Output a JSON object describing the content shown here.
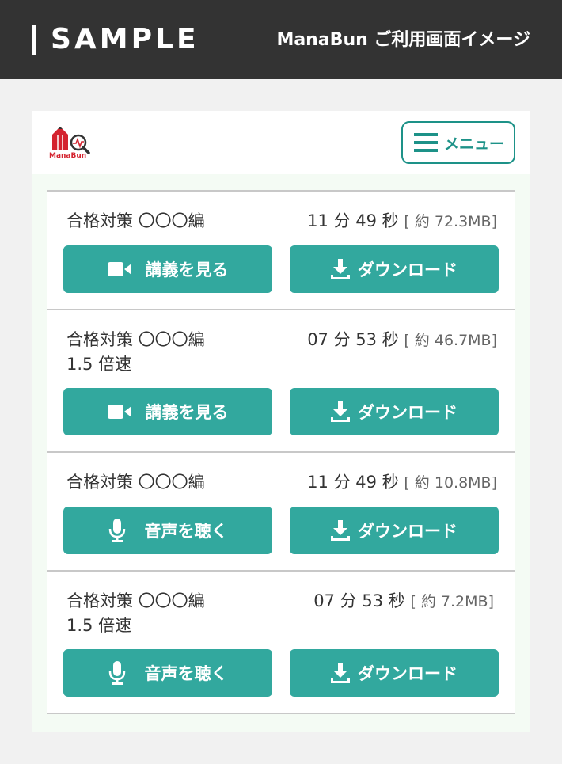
{
  "banner": {
    "sample_label": "SAMPLE",
    "caption": "ManaBun ご利用画面イメージ"
  },
  "header": {
    "logo_text": "ManaBun",
    "menu_label": "メニュー"
  },
  "items": [
    {
      "title": "合格対策 〇〇〇編",
      "subtitle": "",
      "duration": "11 分 49 秒",
      "size": "[ 約 72.3MB]",
      "play_label": "講義を見る",
      "play_icon": "video-camera-icon",
      "download_label": "ダウンロード"
    },
    {
      "title": "合格対策 〇〇〇編",
      "subtitle": "1.5 倍速",
      "duration": "07 分 53 秒",
      "size": "[ 約 46.7MB]",
      "play_label": "講義を見る",
      "play_icon": "video-camera-icon",
      "download_label": "ダウンロード"
    },
    {
      "title": "合格対策 〇〇〇編",
      "subtitle": "",
      "duration": "11 分 49 秒",
      "size": "[ 約 10.8MB]",
      "play_label": "音声を聴く",
      "play_icon": "microphone-icon",
      "download_label": "ダウンロード"
    },
    {
      "title": "合格対策 〇〇〇編",
      "subtitle": "1.5 倍速",
      "duration": "07 分 53 秒",
      "size": "[ 約 7.2MB]",
      "play_label": "音声を聴く",
      "play_icon": "microphone-icon",
      "download_label": "ダウンロード"
    }
  ],
  "colors": {
    "accent": "#32a89e",
    "menu_border": "#1d9288",
    "banner_bg": "#333333",
    "logo_red": "#d4232f"
  }
}
